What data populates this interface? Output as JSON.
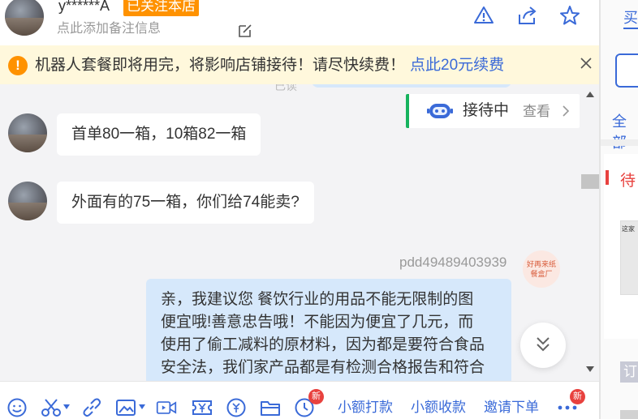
{
  "header": {
    "username": "y******A",
    "follow_badge": "已关注本店",
    "remark_placeholder": "点此添加备注信息"
  },
  "notice": {
    "text": "机器人套餐即将用完，将影响店铺接待！请尽快续费！",
    "link": "点此20元续费"
  },
  "chat": {
    "partial_label": "已读",
    "status": {
      "label": "接待中",
      "view": "查看"
    },
    "messages_in": [
      "首单80一箱，10箱82一箱",
      "外面有的75一箱，你们给74能卖?"
    ],
    "sender": "pdd49489403939",
    "shop_logo_text": [
      "好再来纸",
      "餐盒厂"
    ],
    "message_out_lines": [
      "亲，我建议您 餐饮行业的用品不能无限制的图",
      "便宜哦!善意忠告哦！不能因为便宜了几元，而",
      "使用了偷工减料的原材料，因为都是要符合食品",
      "安全法，我们家产品都是有检测合格报告和符合"
    ]
  },
  "toolbar": {
    "actions": [
      "小额打款",
      "小额收款",
      "邀请下单"
    ],
    "badge_new": "新"
  },
  "right_panel": {
    "tab": "买",
    "filter_all": "全部",
    "pending": "待",
    "product_text": "这家",
    "order_label": "订"
  },
  "colors": {
    "accent": "#3a6ad8",
    "warning": "#ff9200",
    "status_green": "#17b35e",
    "alert_red": "#e8413e",
    "bubble_out": "#d6e8fb"
  }
}
